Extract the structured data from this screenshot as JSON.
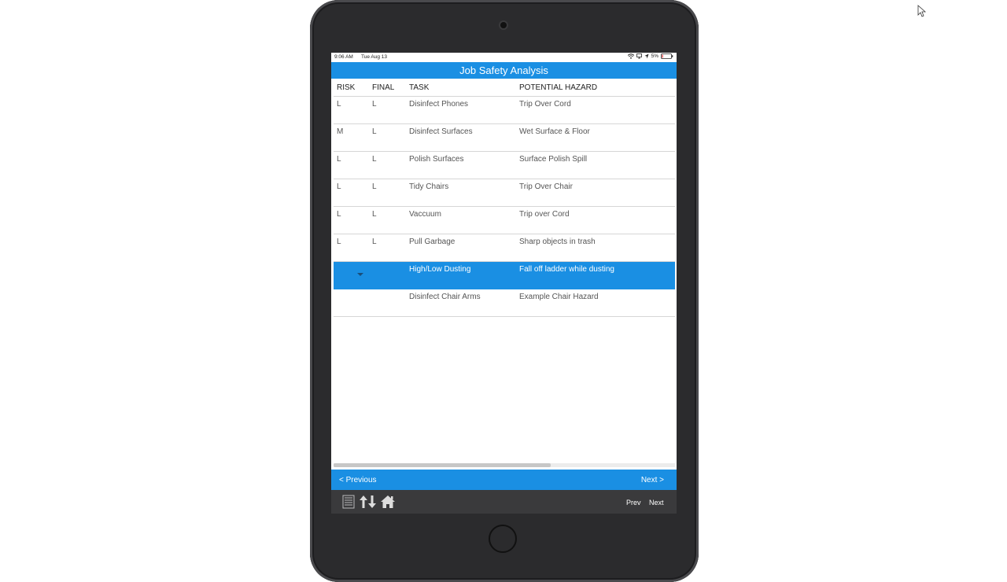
{
  "status_bar": {
    "time": "9:06 AM",
    "date": "Tue Aug 13",
    "battery": "5%"
  },
  "title": "Job Safety Analysis",
  "table": {
    "headers": {
      "risk": "RISK",
      "final": "FINAL",
      "task": "TASK",
      "hazard": "POTENTIAL HAZARD"
    },
    "rows": [
      {
        "risk": "L",
        "final": "L",
        "task": "Disinfect Phones",
        "hazard": "Trip Over Cord"
      },
      {
        "risk": "M",
        "final": "L",
        "task": "Disinfect Surfaces",
        "hazard": "Wet Surface & Floor"
      },
      {
        "risk": "L",
        "final": "L",
        "task": "Polish Surfaces",
        "hazard": "Surface Polish Spill"
      },
      {
        "risk": "L",
        "final": "L",
        "task": "Tidy Chairs",
        "hazard": "Trip Over Chair"
      },
      {
        "risk": "L",
        "final": "L",
        "task": "Vaccuum",
        "hazard": "Trip over Cord"
      },
      {
        "risk": "L",
        "final": "L",
        "task": "Pull Garbage",
        "hazard": "Sharp objects in trash"
      },
      {
        "risk": "",
        "final": "",
        "task": "High/Low Dusting",
        "hazard": "Fall off ladder while dusting"
      },
      {
        "risk": "",
        "final": "",
        "task": "Disinfect Chair Arms",
        "hazard": "Example Chair Hazard"
      }
    ]
  },
  "nav": {
    "previous": "< Previous",
    "next": "Next >"
  },
  "toolbar": {
    "prev": "Prev",
    "next": "Next",
    "icons": [
      "list-icon",
      "sort-icon",
      "home-icon"
    ]
  },
  "colors": {
    "accent": "#1a8fe3",
    "toolbar": "#3a3a3c",
    "device": "#2b2b2d"
  }
}
